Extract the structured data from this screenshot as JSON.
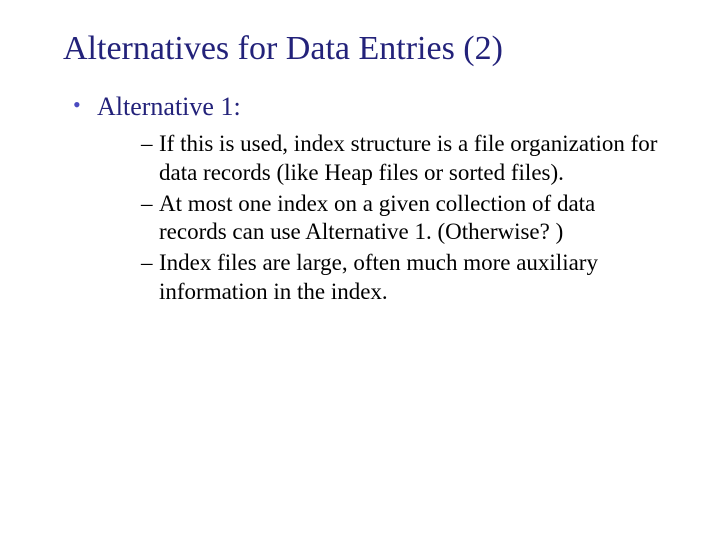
{
  "slide": {
    "title": "Alternatives for Data Entries (2)",
    "bullet": {
      "label": "Alternative 1:",
      "subitems": [
        "If this is used, index structure is a file organization for data records (like Heap files or sorted files).",
        "At most one index on a given collection of data records can use Alternative 1.  (Otherwise? )",
        "Index files are large, often much more auxiliary information in the index."
      ]
    }
  }
}
